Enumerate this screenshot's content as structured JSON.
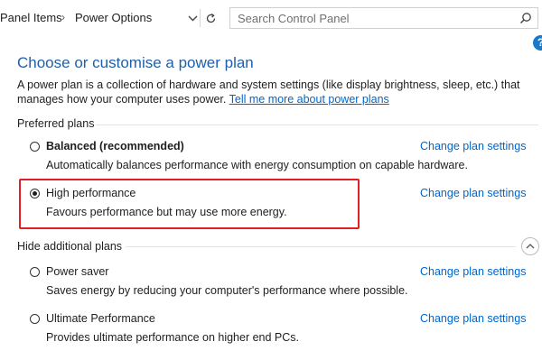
{
  "breadcrumb": {
    "parent": "Panel Items",
    "current": "Power Options"
  },
  "search": {
    "placeholder": "Search Control Panel"
  },
  "page": {
    "title": "Choose or customise a power plan",
    "description": "A power plan is a collection of hardware and system settings (like display brightness, sleep, etc.) that manages how your computer uses power.",
    "learn_more": "Tell me more about power plans"
  },
  "preferred": {
    "label": "Preferred plans",
    "plans": [
      {
        "name": "Balanced (recommended)",
        "description": "Automatically balances performance with energy consumption on capable hardware.",
        "link": "Change plan settings",
        "selected": false
      },
      {
        "name": "High performance",
        "description": "Favours performance but may use more energy.",
        "link": "Change plan settings",
        "selected": true
      }
    ]
  },
  "additional": {
    "label": "Hide additional plans",
    "plans": [
      {
        "name": "Power saver",
        "description": "Saves energy by reducing your computer's performance where possible.",
        "link": "Change plan settings",
        "selected": false
      },
      {
        "name": "Ultimate Performance",
        "description": "Provides ultimate performance on higher end PCs.",
        "link": "Change plan settings",
        "selected": false
      }
    ]
  },
  "colors": {
    "title": "#1f5faa",
    "link": "#0066cc",
    "highlight": "#e21f26",
    "help": "#1979ca"
  },
  "icons": {
    "help": "?"
  }
}
